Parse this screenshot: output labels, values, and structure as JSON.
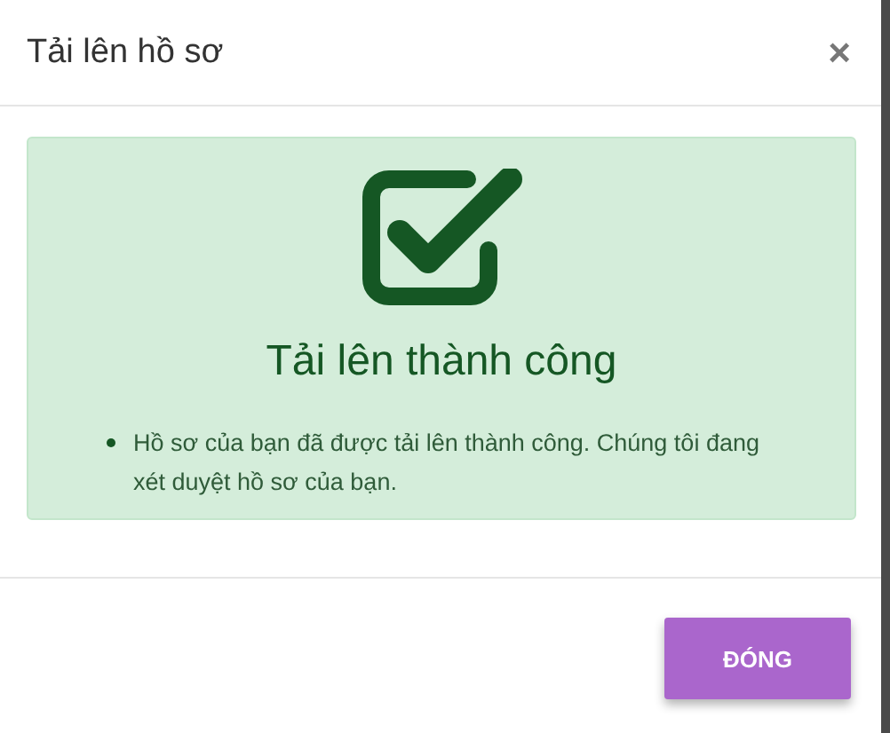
{
  "dialog": {
    "title": "Tải lên hồ sơ",
    "close": "×"
  },
  "alert": {
    "heading": "Tải lên thành công",
    "items": [
      "Hồ sơ của bạn đã được tải lên thành công. Chúng tôi đang xét duyệt hồ sơ của bạn."
    ]
  },
  "buttons": [
    "ĐÓNG"
  ]
}
